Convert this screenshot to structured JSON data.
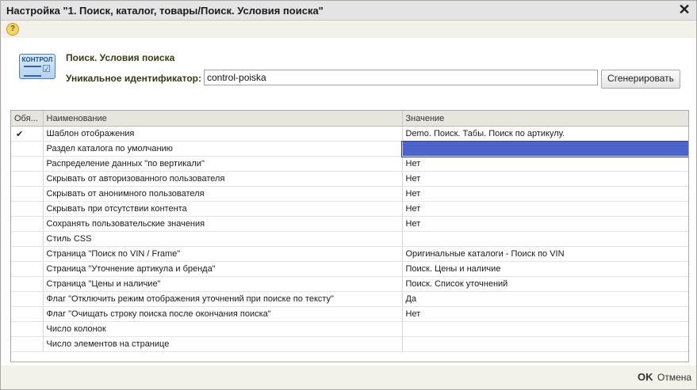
{
  "window": {
    "title": "Настройка \"1. Поиск, каталог, товары/Поиск. Условия поиска\"",
    "close_glyph": "✕",
    "help_glyph": "?"
  },
  "header": {
    "logo_text": "КОНТРОЛ",
    "name": "Поиск. Условия поиска",
    "id_label": "Уникальное идентификатор:",
    "id_value": "control-poiska",
    "generate_label": "Сгенерировать"
  },
  "grid": {
    "columns": [
      "Обя...",
      "Наименование",
      "Значение"
    ],
    "rows": [
      {
        "required": "✔",
        "name": "Шаблон отображения",
        "value": "Demo. Поиск. Табы. Поиск по артикулу."
      },
      {
        "required": "",
        "name": "Раздел каталога по умолчанию",
        "value": ""
      },
      {
        "required": "",
        "name": "Распределение данных \"по вертикали\"",
        "value": "Нет"
      },
      {
        "required": "",
        "name": "Скрывать от авторизованного пользователя",
        "value": "Нет"
      },
      {
        "required": "",
        "name": "Скрывать от анонимного пользователя",
        "value": "Нет"
      },
      {
        "required": "",
        "name": "Скрывать при отсутствии контента",
        "value": "Нет"
      },
      {
        "required": "",
        "name": "Сохранять пользовательские значения",
        "value": "Нет"
      },
      {
        "required": "",
        "name": "Стиль CSS",
        "value": ""
      },
      {
        "required": "",
        "name": "Страница \"Поиск по VIN / Frame\"",
        "value": "Оригинальные каталоги - Поиск по VIN"
      },
      {
        "required": "",
        "name": "Страница \"Уточнение артикула и бренда\"",
        "value": "Поиск. Цены и наличие"
      },
      {
        "required": "",
        "name": "Страница \"Цены и наличие\"",
        "value": "Поиск. Список уточнений"
      },
      {
        "required": "",
        "name": "Флаг \"Отключить режим отображения уточнений при поиске по тексту\"",
        "value": "Да"
      },
      {
        "required": "",
        "name": "Флаг \"Очищать строку поиска после окончания поиска\"",
        "value": "Нет"
      },
      {
        "required": "",
        "name": "Число колонок",
        "value": ""
      },
      {
        "required": "",
        "name": "Число элементов на странице",
        "value": ""
      }
    ]
  },
  "footer": {
    "ok_label": "OK",
    "cancel_label": "Отмена"
  },
  "colors": {
    "selection": "#4b64c9",
    "window_bg": "#f2f1ea"
  }
}
